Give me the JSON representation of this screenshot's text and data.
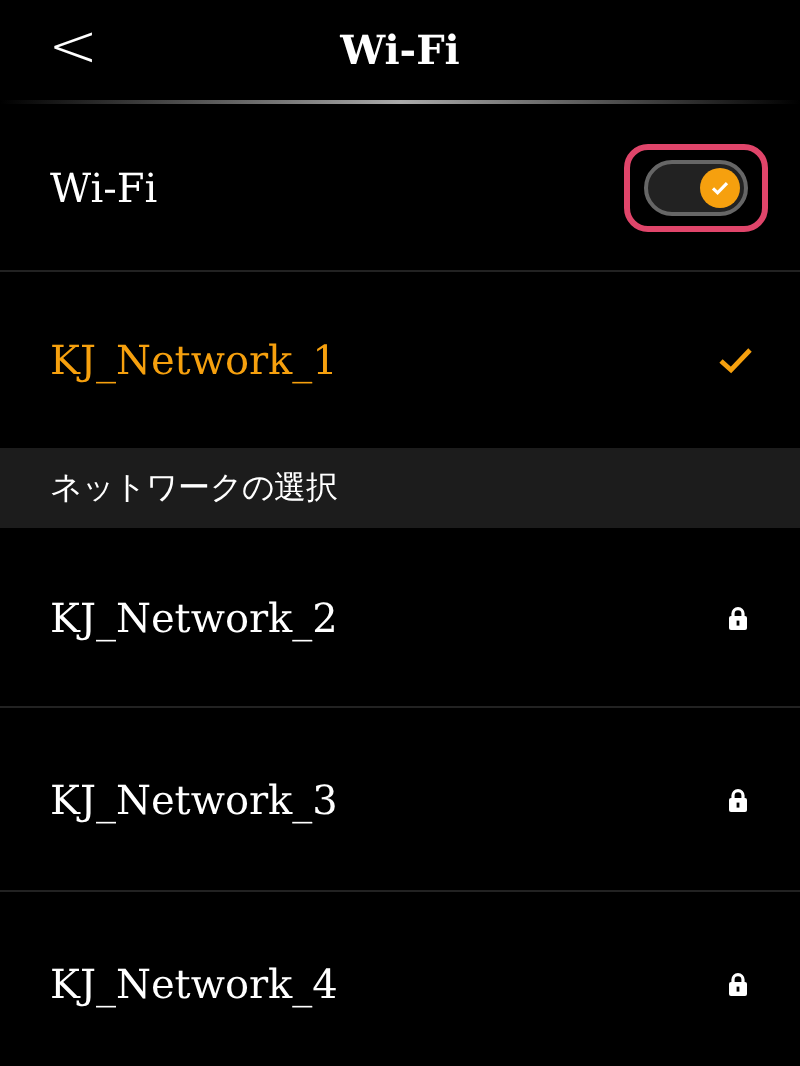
{
  "header": {
    "back": "<",
    "title": "Wi-Fi"
  },
  "wifi": {
    "label": "Wi-Fi",
    "on": true,
    "highlighted": true
  },
  "current_network": {
    "name": "KJ_Network_1",
    "connected": true
  },
  "section_title": "ネットワークの選択",
  "networks": [
    {
      "name": "KJ_Network_2",
      "locked": true
    },
    {
      "name": "KJ_Network_3",
      "locked": true
    },
    {
      "name": "KJ_Network_4",
      "locked": true
    }
  ]
}
